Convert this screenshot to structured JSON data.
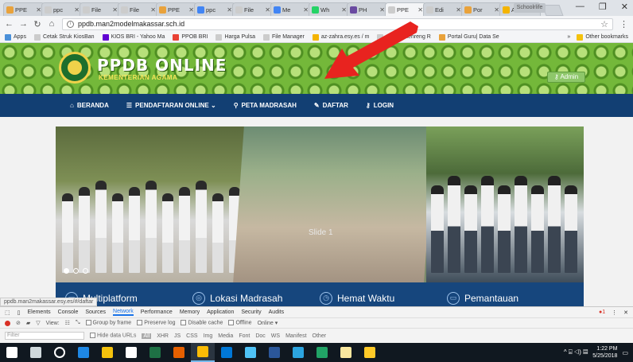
{
  "browser": {
    "tabs": [
      {
        "label": "PPE",
        "color": "#e9a23b"
      },
      {
        "label": "ppc",
        "color": "#cccccc"
      },
      {
        "label": "File",
        "color": "#cccccc"
      },
      {
        "label": "File",
        "color": "#cccccc"
      },
      {
        "label": "PPE",
        "color": "#e9a23b"
      },
      {
        "label": "ppc",
        "color": "#4285f4"
      },
      {
        "label": "File",
        "color": "#cccccc"
      },
      {
        "label": "Me",
        "color": "#4285f4"
      },
      {
        "label": "Wh",
        "color": "#25d366"
      },
      {
        "label": "PH",
        "color": "#6a4aa1"
      },
      {
        "label": "PPE",
        "color": "#cccccc",
        "active": true
      },
      {
        "label": "Edi",
        "color": "#cccccc"
      },
      {
        "label": "Por",
        "color": "#e9a23b"
      },
      {
        "label": "Anc",
        "color": "#f4b400"
      }
    ],
    "user_chip": "Schoolrlife",
    "window_controls": {
      "minimize": "—",
      "maximize": "❐",
      "close": "✕"
    },
    "url": "ppdb.man2modelmakassar.sch.id",
    "bookmarks": [
      {
        "label": "Apps",
        "color": "#4a90d9"
      },
      {
        "label": "Cetak Struk KiosBan",
        "color": "#cccccc"
      },
      {
        "label": "KIOS BRI - Yahoo Ma",
        "color": "#6001d2"
      },
      {
        "label": "PPOB BRI",
        "color": "#e94235"
      },
      {
        "label": "Harga Pulsa",
        "color": "#cccccc"
      },
      {
        "label": "File Manager",
        "color": "#cccccc"
      },
      {
        "label": "az-zahra.esy.es / m",
        "color": "#f4b400"
      },
      {
        "label": "SN 1 Sidenreng R",
        "color": "#cccccc"
      },
      {
        "label": "Portal Guru| Data Se",
        "color": "#e9a23b"
      }
    ],
    "bookmarks_overflow": "»",
    "other_bookmarks": "Other bookmarks"
  },
  "site": {
    "title": "PPDB ONLINE",
    "subtitle": "KEMENTERIAN AGAMA",
    "admin_button": "Admin",
    "nav": [
      {
        "label": "BERANDA",
        "icon": "home-icon",
        "glyph": "⌂"
      },
      {
        "label": "PENDAFTARAN ONLINE ⌄",
        "icon": "list-icon",
        "glyph": "☰"
      },
      {
        "label": "PETA MADRASAH",
        "icon": "map-pin-icon",
        "glyph": "⚲"
      },
      {
        "label": "DAFTAR",
        "icon": "edit-icon",
        "glyph": "✎",
        "active": true
      },
      {
        "label": "LOGIN",
        "icon": "key-icon",
        "glyph": "⚷"
      }
    ],
    "slider": {
      "caption": "Slide 1",
      "active_dot": 0,
      "dot_count": 3
    },
    "features": [
      {
        "label": "Multiplatform",
        "icon": "device-icon",
        "glyph": "▭"
      },
      {
        "label": "Lokasi Madrasah",
        "icon": "location-icon",
        "glyph": "◎"
      },
      {
        "label": "Hemat Waktu",
        "icon": "clock-icon",
        "glyph": "◷"
      },
      {
        "label": "Pemantauan",
        "icon": "monitor-icon",
        "glyph": "▭"
      }
    ],
    "status_url": "ppdb.man2makassar.esy.es/#/daftar"
  },
  "devtools": {
    "tabs": [
      "Elements",
      "Console",
      "Sources",
      "Network",
      "Performance",
      "Memory",
      "Application",
      "Security",
      "Audits"
    ],
    "active_tab": "Network",
    "error_count": "1",
    "toolbar": {
      "view_label": "View:",
      "group_by_frame": "Group by frame",
      "preserve_log": "Preserve log",
      "disable_cache": "Disable cache",
      "offline": "Offline",
      "online": "Online"
    },
    "filter": {
      "placeholder": "Filter",
      "hide_data_urls": "Hide data URLs",
      "types": [
        "All",
        "XHR",
        "JS",
        "CSS",
        "Img",
        "Media",
        "Font",
        "Doc",
        "WS",
        "Manifest",
        "Other"
      ]
    }
  },
  "taskbar": {
    "apps": [
      {
        "name": "start-icon",
        "color": "#ffffff"
      },
      {
        "name": "task-view-icon",
        "color": "#cfd8dc"
      },
      {
        "name": "cortana-icon",
        "color": "#ffffff"
      },
      {
        "name": "edge-icon",
        "color": "#1e88e5"
      },
      {
        "name": "file-explorer-icon",
        "color": "#f4c20d"
      },
      {
        "name": "store-icon",
        "color": "#ffffff"
      },
      {
        "name": "excel-icon",
        "color": "#1e7145"
      },
      {
        "name": "firefox-icon",
        "color": "#e66000"
      },
      {
        "name": "chrome-icon",
        "color": "#fbbc05",
        "active": true
      },
      {
        "name": "mail-icon",
        "color": "#0078d7"
      },
      {
        "name": "notepad-icon",
        "color": "#4fc3f7"
      },
      {
        "name": "photos-icon",
        "color": "#2b579a"
      },
      {
        "name": "telegram-icon",
        "color": "#2ca5e0"
      },
      {
        "name": "excel2-icon",
        "color": "#21a366"
      },
      {
        "name": "paint-icon",
        "color": "#f9e79f"
      },
      {
        "name": "music-icon",
        "color": "#ffca28"
      }
    ],
    "tray_glyphs": "^ ⌸ ◁) ▤",
    "time": "1:22 PM",
    "date": "5/25/2018"
  }
}
